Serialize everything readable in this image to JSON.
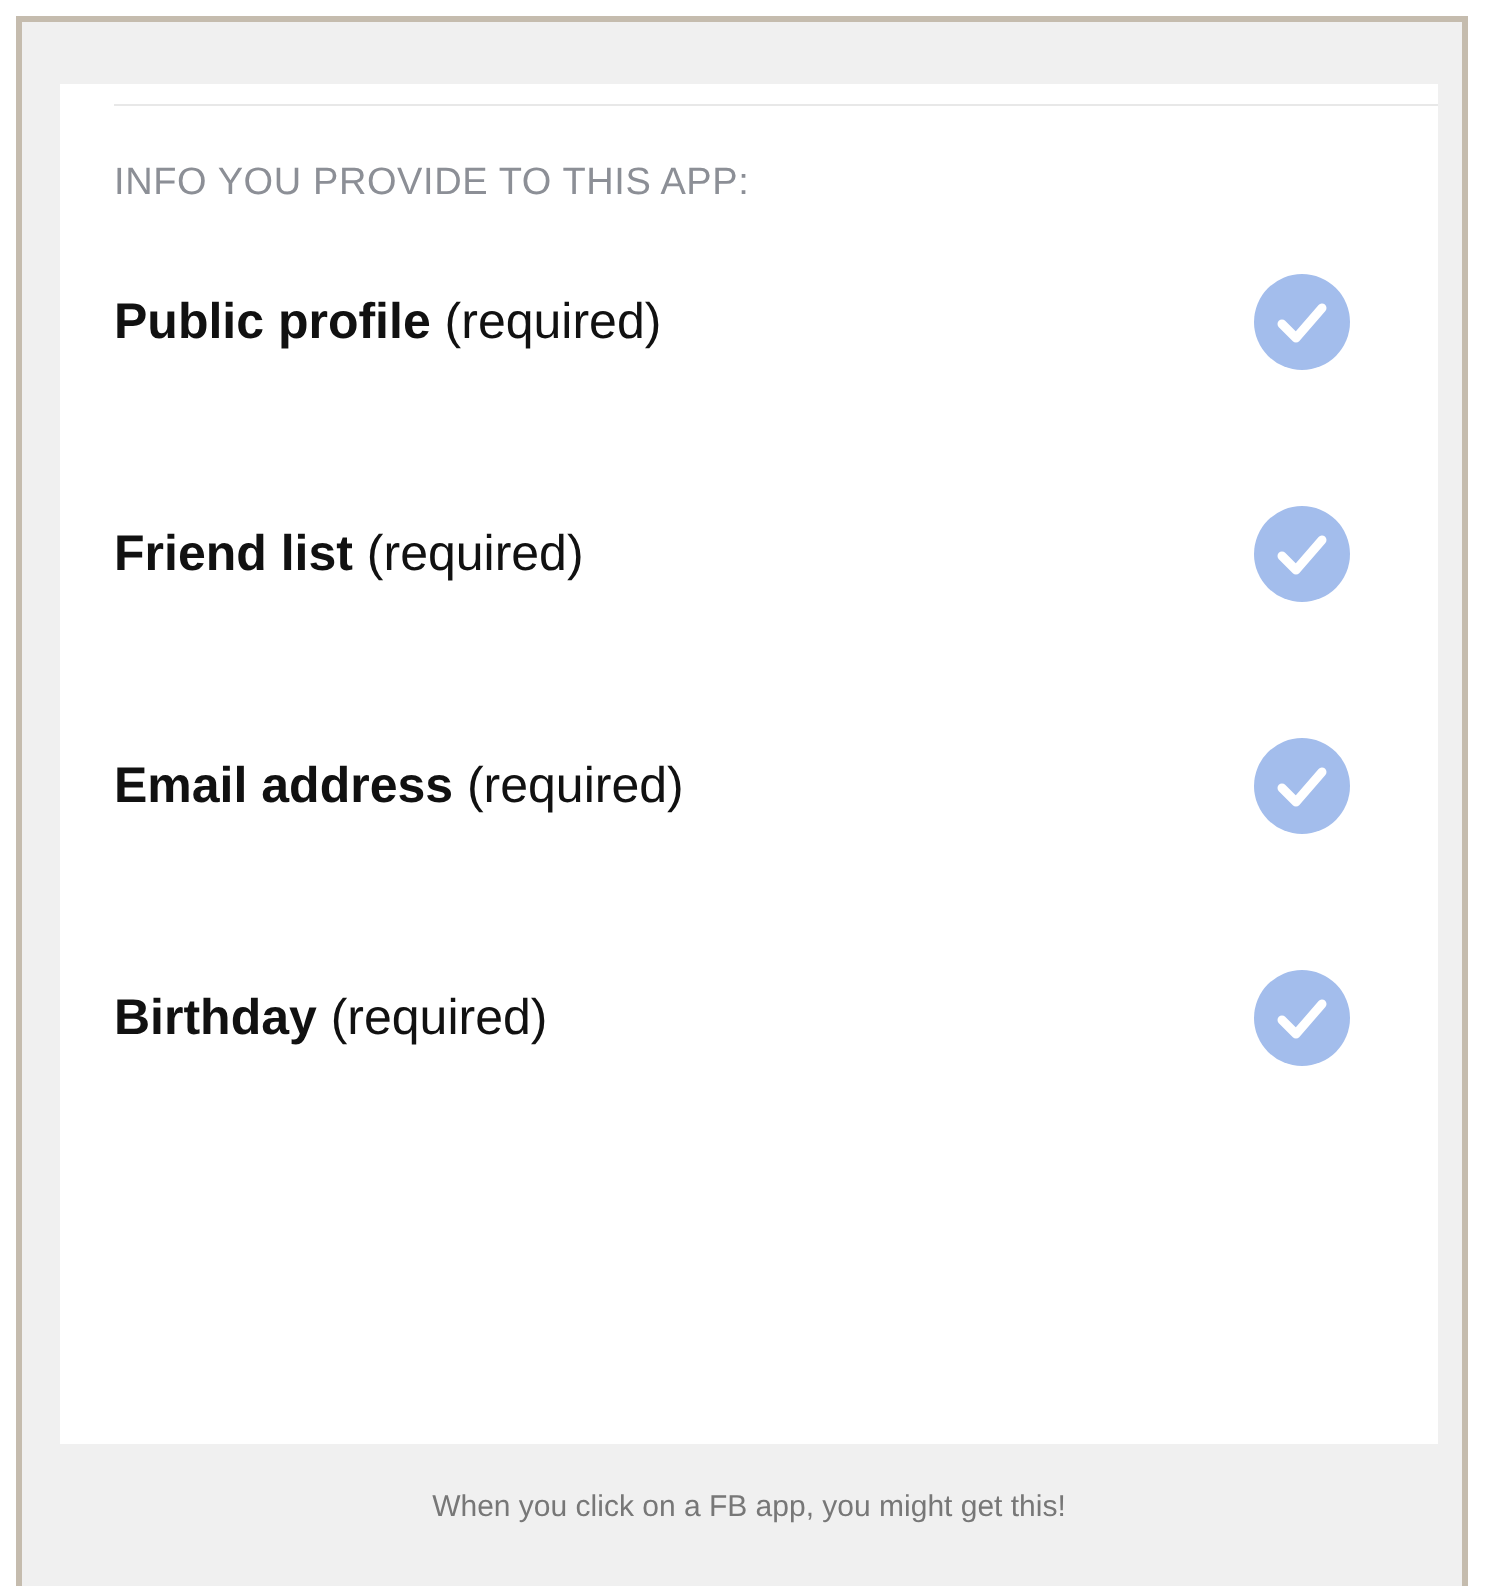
{
  "section_title": "INFO YOU PROVIDE TO THIS APP:",
  "permissions": [
    {
      "label": "**Public profile** (required)",
      "checked": true
    },
    {
      "label": "**Friend list** (required)",
      "checked": true
    },
    {
      "label": "**Email address** (required)",
      "checked": true
    },
    {
      "label": "**Birthday** (required)",
      "checked": true
    }
  ],
  "caption": "When you click on a FB app, you might get this!"
}
